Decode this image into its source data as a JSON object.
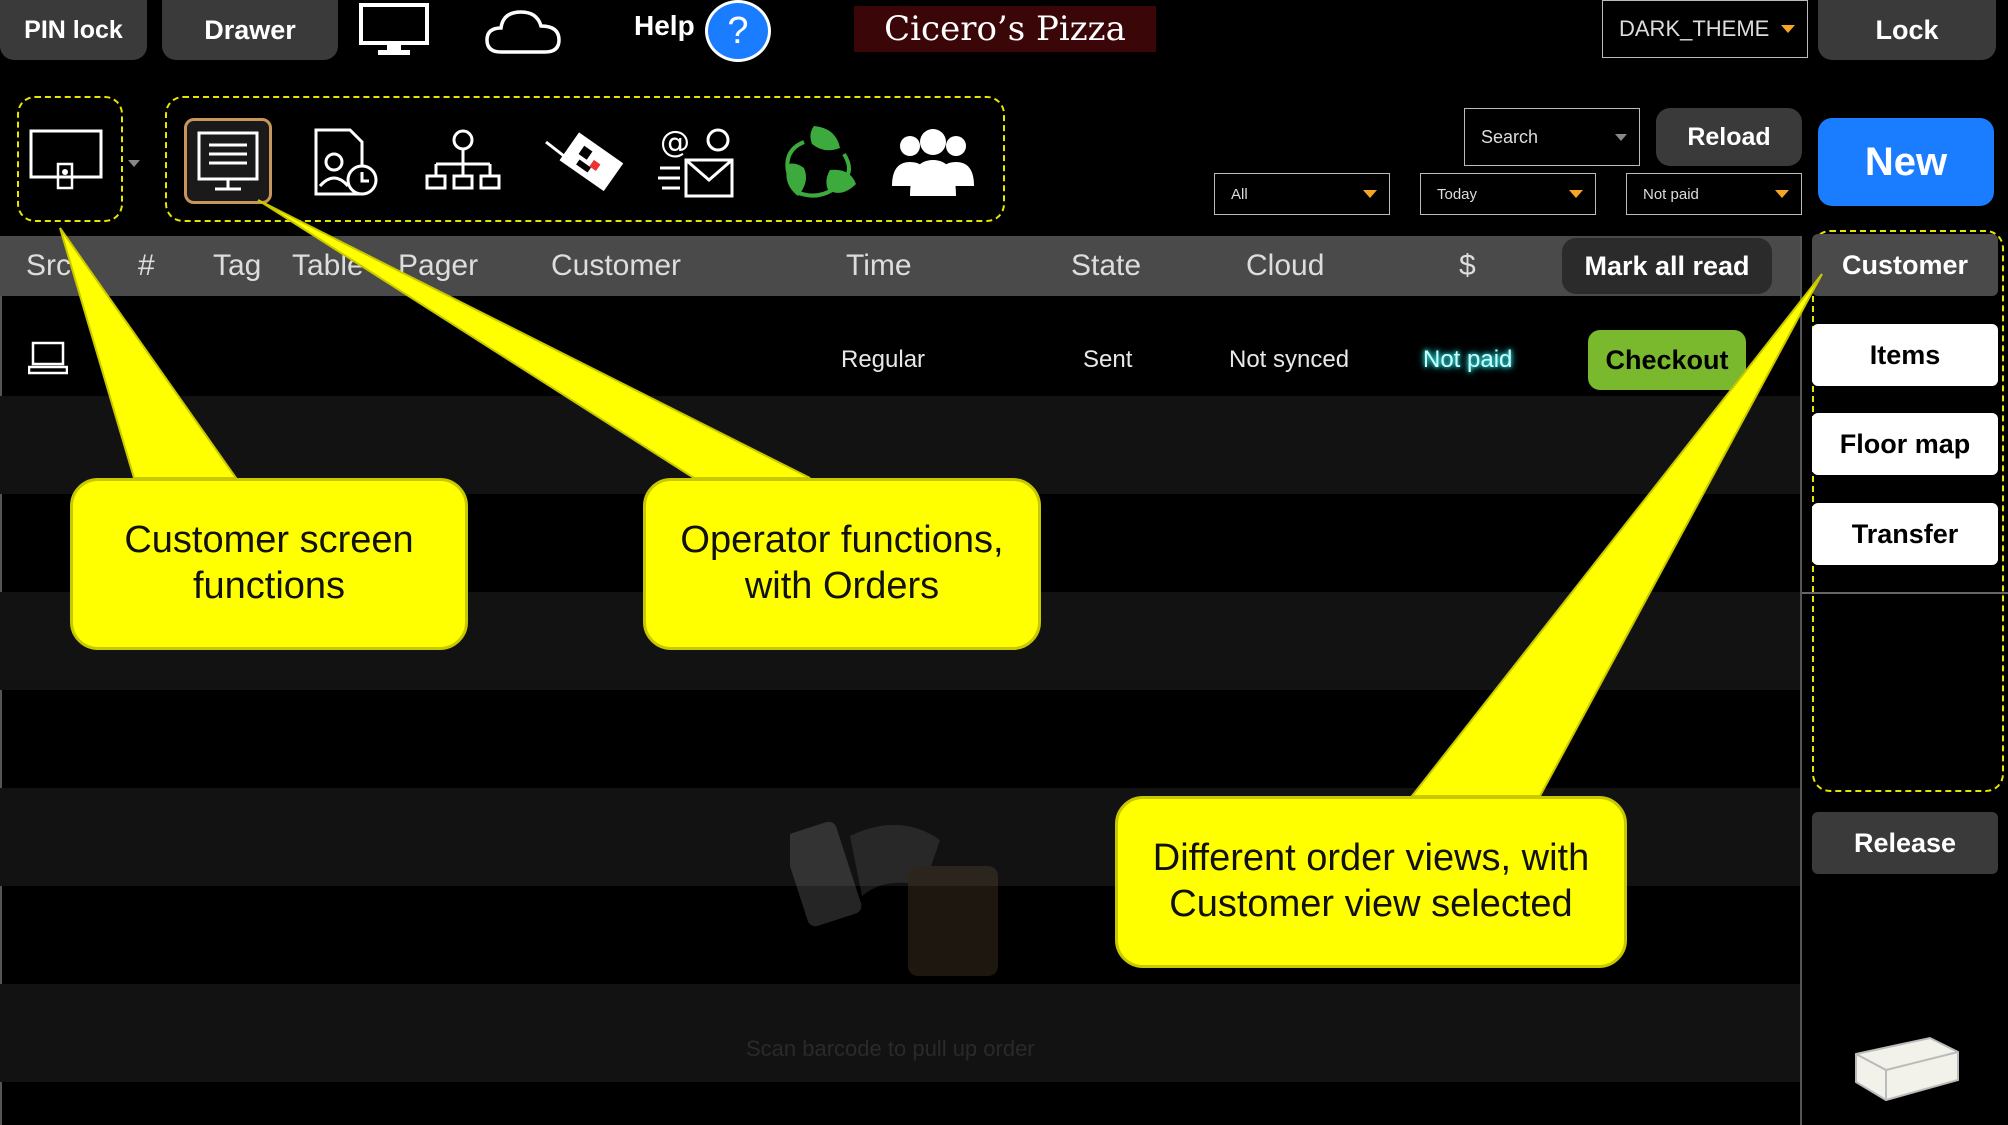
{
  "topbar": {
    "pin_lock": "PIN lock",
    "drawer": "Drawer",
    "help": "Help",
    "help_glyph": "?",
    "brand": "Cicero’s Pizza",
    "theme_value": "DARK_THEME",
    "lock": "Lock"
  },
  "toolbar": {
    "search_placeholder": "Search",
    "reload": "Reload",
    "new": "New",
    "filter_all": "All",
    "filter_today": "Today",
    "filter_not_paid": "Not paid"
  },
  "table": {
    "columns": [
      "Src",
      "#",
      "Tag",
      "Table",
      "Pager",
      "Customer",
      "Time",
      "State",
      "Cloud",
      "$"
    ],
    "mark_all_read": "Mark all read",
    "rows": [
      {
        "time": "Regular",
        "state": "Sent",
        "cloud": "Not synced",
        "paid": "Not paid",
        "action": "Checkout"
      }
    ],
    "empty_hint": "Scan barcode to pull up order"
  },
  "sidebar": {
    "customer": "Customer",
    "items": "Items",
    "floor_map": "Floor map",
    "transfer": "Transfer",
    "release": "Release"
  },
  "callouts": {
    "customer_screen": "Customer screen functions",
    "operator": "Operator functions, with Orders",
    "views": "Different order views, with Customer view selected"
  },
  "colors": {
    "callout_yellow": "#ffff00",
    "new_blue": "#1a7cff",
    "checkout_green": "#7ab82e",
    "not_paid_glow": "#9ff"
  }
}
